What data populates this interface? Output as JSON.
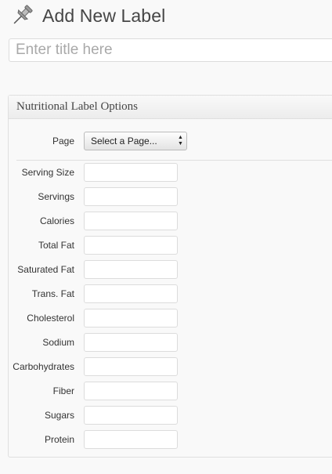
{
  "header": {
    "title": "Add New Label",
    "icon": "pushpin-icon"
  },
  "title_field": {
    "placeholder": "Enter title here",
    "value": ""
  },
  "metabox": {
    "title": "Nutritional Label Options",
    "page": {
      "label": "Page",
      "selected": "Select a Page..."
    },
    "fields": [
      {
        "label": "Serving Size",
        "value": ""
      },
      {
        "label": "Servings",
        "value": ""
      },
      {
        "label": "Calories",
        "value": ""
      },
      {
        "label": "Total Fat",
        "value": ""
      },
      {
        "label": "Saturated Fat",
        "value": ""
      },
      {
        "label": "Trans. Fat",
        "value": ""
      },
      {
        "label": "Cholesterol",
        "value": ""
      },
      {
        "label": "Sodium",
        "value": ""
      },
      {
        "label": "Carbohydrates",
        "value": ""
      },
      {
        "label": "Fiber",
        "value": ""
      },
      {
        "label": "Sugars",
        "value": ""
      },
      {
        "label": "Protein",
        "value": ""
      }
    ]
  }
}
